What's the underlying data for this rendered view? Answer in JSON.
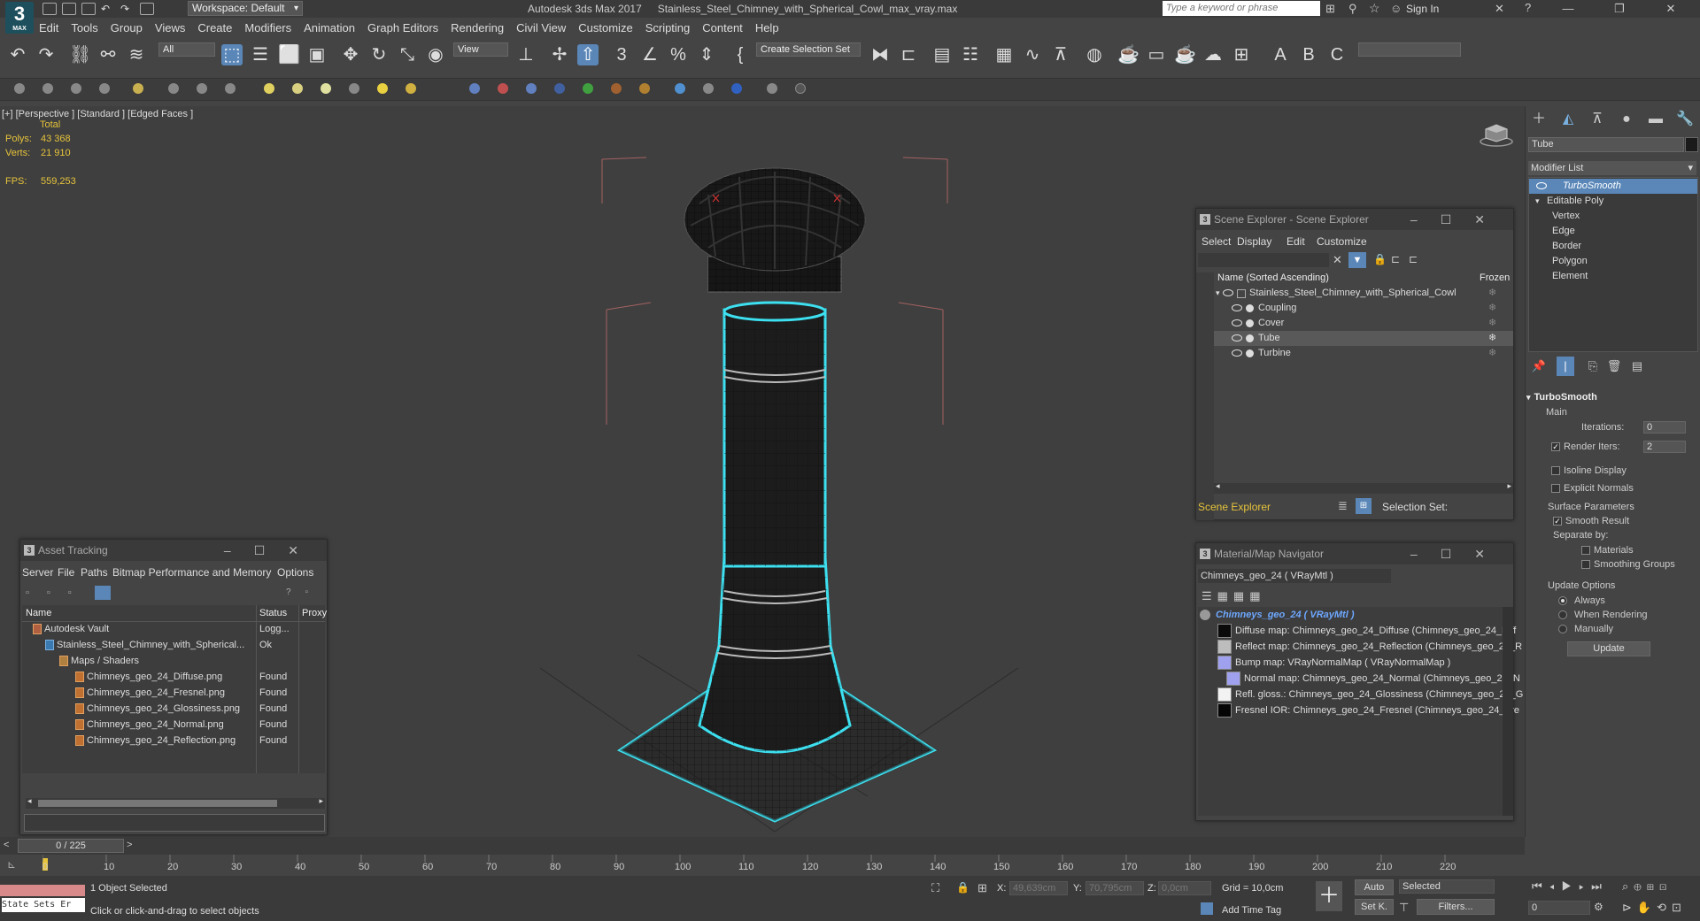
{
  "app": {
    "logo_text": "3",
    "logo_sub": "MAX",
    "workspace_label": "Workspace: Default",
    "title": "Autodesk 3ds Max 2017",
    "filename": "Stainless_Steel_Chimney_with_Spherical_Cowl_max_vray.max",
    "search_placeholder": "Type a keyword or phrase",
    "sign_in": "Sign In"
  },
  "menu": [
    "Edit",
    "Tools",
    "Group",
    "Views",
    "Create",
    "Modifiers",
    "Animation",
    "Graph Editors",
    "Rendering",
    "Civil View",
    "Customize",
    "Scripting",
    "Content",
    "Help"
  ],
  "toolbar": {
    "filter_value": "All",
    "refcoord_value": "View",
    "selection_set_label": "Create Selection Set"
  },
  "viewport": {
    "label": "[+] [Perspective ] [Standard ] [Edged Faces ]",
    "total_label": "Total",
    "polys_label": "Polys:",
    "polys_value": "43 368",
    "verts_label": "Verts:",
    "verts_value": "21 910",
    "fps_label": "FPS:",
    "fps_value": "559,253"
  },
  "command_panel": {
    "object_name": "Tube",
    "modifier_list_label": "Modifier List",
    "stack": [
      "TurboSmooth",
      "Editable Poly",
      "Vertex",
      "Edge",
      "Border",
      "Polygon",
      "Element"
    ],
    "turbosmooth": {
      "title": "TurboSmooth",
      "main_label": "Main",
      "iterations_label": "Iterations:",
      "iterations_value": "0",
      "render_iters_label": "Render Iters:",
      "render_iters_value": "2",
      "isoline_label": "Isoline Display",
      "explicit_normals_label": "Explicit Normals",
      "surface_params_label": "Surface Parameters",
      "smooth_result_label": "Smooth Result",
      "separate_by_label": "Separate by:",
      "materials_label": "Materials",
      "smoothing_groups_label": "Smoothing Groups",
      "update_options_label": "Update Options",
      "always_label": "Always",
      "when_rendering_label": "When Rendering",
      "manually_label": "Manually",
      "update_button": "Update"
    }
  },
  "scene_explorer": {
    "title": "Scene Explorer - Scene Explorer",
    "menu": [
      "Select",
      "Display",
      "Edit",
      "Customize"
    ],
    "col_name": "Name (Sorted Ascending)",
    "col_frozen": "Frozen",
    "root": "Stainless_Steel_Chimney_with_Spherical_Cowl",
    "children": [
      "Coupling",
      "Cover",
      "Tube",
      "Turbine"
    ],
    "footer_label": "Scene Explorer",
    "selection_set_label": "Selection Set:"
  },
  "asset_tracking": {
    "title": "Asset Tracking",
    "menu": [
      "Server",
      "File",
      "Paths",
      "Bitmap Performance and Memory",
      "Options"
    ],
    "columns": [
      "Name",
      "Status",
      "Proxy"
    ],
    "rows": [
      {
        "name": "Autodesk Vault",
        "status": "Logg..."
      },
      {
        "name": "Stainless_Steel_Chimney_with_Spherical...",
        "status": "Ok"
      },
      {
        "name": "Maps / Shaders",
        "status": ""
      },
      {
        "name": "Chimneys_geo_24_Diffuse.png",
        "status": "Found"
      },
      {
        "name": "Chimneys_geo_24_Fresnel.png",
        "status": "Found"
      },
      {
        "name": "Chimneys_geo_24_Glossiness.png",
        "status": "Found"
      },
      {
        "name": "Chimneys_geo_24_Normal.png",
        "status": "Found"
      },
      {
        "name": "Chimneys_geo_24_Reflection.png",
        "status": "Found"
      }
    ]
  },
  "material_navigator": {
    "title": "Material/Map Navigator",
    "current": "Chimneys_geo_24  ( VRayMtl )",
    "root": "Chimneys_geo_24  ( VRayMtl )",
    "items": [
      "Diffuse map: Chimneys_geo_24_Diffuse (Chimneys_geo_24_Diff",
      "Reflect map: Chimneys_geo_24_Reflection (Chimneys_geo_24_R",
      "Bump map: VRayNormalMap  ( VRayNormalMap )",
      "Normal map: Chimneys_geo_24_Normal (Chimneys_geo_24_N",
      "Refl. gloss.: Chimneys_geo_24_Glossiness (Chimneys_geo_24_G",
      "Fresnel IOR: Chimneys_geo_24_Fresnel (Chimneys_geo_24_Fre"
    ],
    "swatch_colors": [
      "#0a0a0a",
      "#bdbdbd",
      "#9fa0ee",
      "#9fa0ee",
      "#f2f2f2",
      "#050505"
    ]
  },
  "timeline": {
    "frame_label": "0 / 225",
    "ticks": [
      "0",
      "10",
      "20",
      "30",
      "40",
      "50",
      "60",
      "70",
      "80",
      "90",
      "100",
      "110",
      "120",
      "130",
      "140",
      "150",
      "160",
      "170",
      "180",
      "190",
      "200",
      "210",
      "220"
    ]
  },
  "status": {
    "state_sets": "State Sets Er",
    "selected_text": "1 Object Selected",
    "prompt": "Click or click-and-drag to select objects",
    "x_label": "X:",
    "x_value": "49,639cm",
    "y_label": "Y:",
    "y_value": "70,795cm",
    "z_label": "Z:",
    "z_value": "0,0cm",
    "grid": "Grid = 10,0cm",
    "add_time_tag": "Add Time Tag",
    "auto": "Auto",
    "selected_dropdown": "Selected",
    "set_k": "Set K.",
    "filters": "Filters...",
    "frame_value": "0"
  },
  "colors": {
    "accent": "#5a87b8",
    "stat_yellow": "#e6c33b",
    "selection_cyan": "#3de0f0"
  }
}
